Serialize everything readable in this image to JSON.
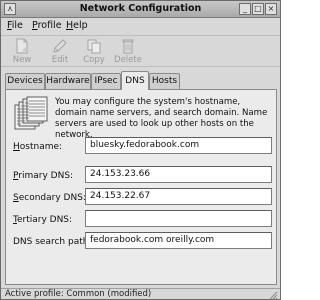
{
  "window": {
    "title": "Network Configuration",
    "controls": {
      "left": "⋏",
      "minimize": "_",
      "maximize": "□",
      "close": "×"
    }
  },
  "menubar": {
    "items": [
      {
        "label": "File",
        "mnemonic": "F",
        "rest": "ile"
      },
      {
        "label": "Profile",
        "mnemonic": "P",
        "rest": "rofile"
      },
      {
        "label": "Help",
        "mnemonic": "H",
        "rest": "elp"
      }
    ]
  },
  "toolbar": {
    "buttons": [
      {
        "label": "New",
        "icon": "new-document-icon",
        "enabled": false
      },
      {
        "label": "Edit",
        "icon": "edit-pencil-icon",
        "enabled": false
      },
      {
        "label": "Copy",
        "icon": "copy-icon",
        "enabled": false
      },
      {
        "label": "Delete",
        "icon": "delete-trash-icon",
        "enabled": false
      }
    ]
  },
  "tabs": [
    {
      "label": "Devices",
      "active": false
    },
    {
      "label": "Hardware",
      "active": false
    },
    {
      "label": "IPsec",
      "active": false
    },
    {
      "label": "DNS",
      "active": true
    },
    {
      "label": "Hosts",
      "active": false
    }
  ],
  "dns": {
    "intro": "You may configure the system's hostname, domain name servers, and search domain. Name servers are used to look up other hosts on the network.",
    "intro_icon": "server-stack-icon",
    "fields": {
      "hostname": {
        "label_pre": "",
        "mnemonic": "H",
        "label_post": "ostname:",
        "value": "bluesky.fedorabook.com"
      },
      "primary_dns": {
        "label_pre": "",
        "mnemonic": "P",
        "label_post": "rimary DNS:",
        "value": "24.153.23.66"
      },
      "secondary_dns": {
        "label_pre": "",
        "mnemonic": "S",
        "label_post": "econdary DNS:",
        "value": "24.153.22.67"
      },
      "tertiary_dns": {
        "label_pre": "",
        "mnemonic": "T",
        "label_post": "ertiary DNS:",
        "value": ""
      },
      "search_path": {
        "label_pre": "DNS search path:",
        "mnemonic": "",
        "label_post": "",
        "value": "fedorabook.com oreilly.com"
      }
    }
  },
  "status": {
    "text": "Active profile: Common (modified)"
  }
}
